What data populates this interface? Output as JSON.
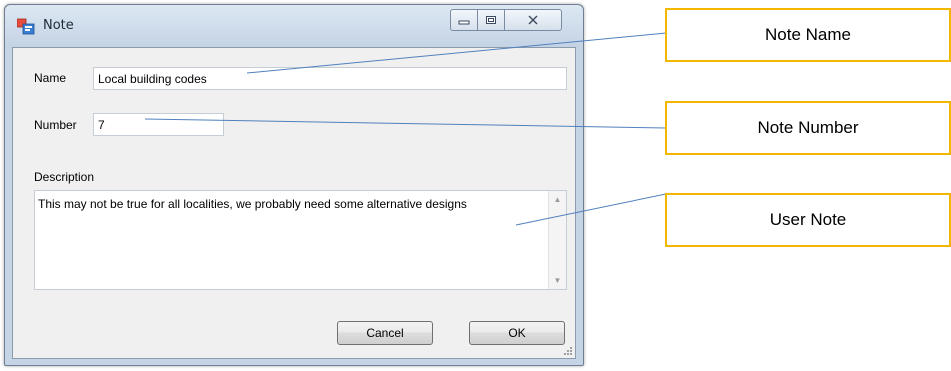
{
  "window": {
    "title": "Note",
    "controls": {
      "minimize": "minimize",
      "maximize": "maximize",
      "close": "close"
    }
  },
  "form": {
    "name_label": "Name",
    "name_value": "Local building codes",
    "number_label": "Number",
    "number_value": "7",
    "description_label": "Description",
    "description_value": "This may not be true for all localities, we probably need some alternative designs"
  },
  "buttons": {
    "cancel": "Cancel",
    "ok": "OK"
  },
  "callouts": [
    {
      "label": "Note Name"
    },
    {
      "label": "Note Number"
    },
    {
      "label": "User Note"
    }
  ],
  "colors": {
    "callout_border": "#f2b800",
    "leader_line": "#4f81bd"
  }
}
